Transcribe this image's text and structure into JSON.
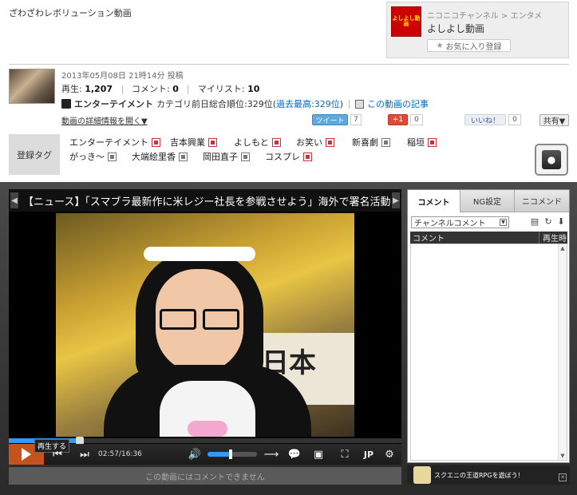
{
  "page_title": "ざわざわレボリューション動画",
  "channel": {
    "logo_text": "よしよし動画",
    "crumb_channel": "ニコニコチャンネル",
    "crumb_sep": ">",
    "crumb_category": "エンタメ",
    "name": "よしよし動画",
    "fav_label": "お気に入り登録"
  },
  "video": {
    "post_date": "2013年05月08日 21時14分 投稿",
    "plays_label": "再生:",
    "plays": "1,207",
    "comments_label": "コメント:",
    "comments": "0",
    "mylist_label": "マイリスト:",
    "mylist": "10",
    "category": "エンターテイメント",
    "rank_prefix": "カテゴリ前日総合順位:329位(",
    "rank_link": "過去最高:329位",
    "rank_suffix": ")",
    "article_link": "この動画の記事",
    "detail_link": "動画の詳細情報を開く▼",
    "title": "【ニュース】「スマブラ最新作に米レジー社長を参戦させよう」海外で署名活動",
    "sign_text": "日本"
  },
  "share": {
    "tweet_label": "ツイート",
    "tweet_count": "7",
    "gplus_label": "+1",
    "gplus_count": "0",
    "fb_label": "いいね！",
    "fb_count": "0",
    "share_label": "共有▼"
  },
  "tags": {
    "label": "登録タグ",
    "row1": [
      "エンターテイメント",
      "吉本興業",
      "よしもと",
      "お笑い",
      "新喜劇",
      "稲垣"
    ],
    "row2": [
      "がっき～",
      "大端絵里香",
      "岡田直子",
      "コスプレ"
    ]
  },
  "player": {
    "play_tooltip": "再生する",
    "time": "02:57/16:36",
    "lang": "JP",
    "comment_disabled": "この動画にはコメントできません",
    "seek_fraction": 0.178,
    "volume_fraction": 0.5
  },
  "comment_panel": {
    "tab_comment": "コメント",
    "tab_ng": "NG設定",
    "tab_nicommend": "ニコメンド",
    "select_value": "チャンネルコメント",
    "col_comment": "コメント",
    "col_time": "再生時"
  },
  "ad": {
    "text": "スクエニの王道RPGを遊ぼう！"
  }
}
